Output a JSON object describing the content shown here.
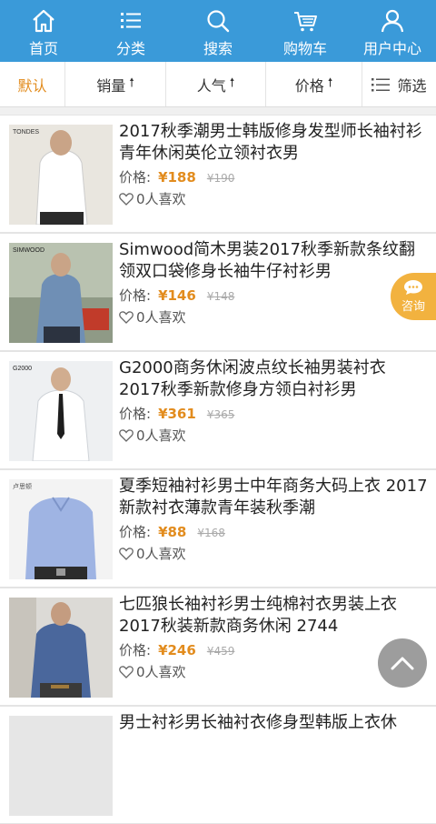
{
  "nav": {
    "items": [
      {
        "label": "首页",
        "icon": "home-icon"
      },
      {
        "label": "分类",
        "icon": "list-icon"
      },
      {
        "label": "搜索",
        "icon": "search-icon"
      },
      {
        "label": "购物车",
        "icon": "cart-icon"
      },
      {
        "label": "用户中心",
        "icon": "user-icon"
      }
    ]
  },
  "sort": {
    "default": "默认",
    "sales": "销量",
    "popularity": "人气",
    "price": "价格",
    "filter": "筛选",
    "arrow": "🠕"
  },
  "products": [
    {
      "title": "2017秋季潮男士韩版修身发型师长袖衬衫 青年休闲英伦立领衬衣男",
      "price_label": "价格:",
      "price": "¥188",
      "old_price": "¥190",
      "likes": "0人喜欢",
      "thumb_brand": "TONDES"
    },
    {
      "title": "Simwood简木男装2017秋季新款条纹翻领双口袋修身长袖牛仔衬衫男",
      "price_label": "价格:",
      "price": "¥146",
      "old_price": "¥148",
      "likes": "0人喜欢",
      "thumb_brand": "SIMWOOD"
    },
    {
      "title": "G2000商务休闲波点纹长袖男装衬衣 2017秋季新款修身方领白衬衫男",
      "price_label": "价格:",
      "price": "¥361",
      "old_price": "¥365",
      "likes": "0人喜欢",
      "thumb_brand": "G2000"
    },
    {
      "title": "夏季短袖衬衫男士中年商务大码上衣 2017新款衬衣薄款青年装秋季潮",
      "price_label": "价格:",
      "price": "¥88",
      "old_price": "¥168",
      "likes": "0人喜欢",
      "thumb_brand": "卢思顿"
    },
    {
      "title": "七匹狼长袖衬衫男士纯棉衬衣男装上衣 2017秋装新款商务休闲 2744",
      "price_label": "价格:",
      "price": "¥246",
      "old_price": "¥459",
      "likes": "0人喜欢",
      "thumb_brand": ""
    },
    {
      "title": "男士衬衫男长袖衬衣修身型韩版上衣休",
      "price_label": "",
      "price": "",
      "old_price": "",
      "likes": "",
      "thumb_brand": ""
    }
  ],
  "consult": {
    "label": "咨询"
  },
  "colors": {
    "nav_bg": "#3a9ad9",
    "accent": "#e28c1e",
    "consult_bg": "#f2b23f",
    "totop_bg": "#9d9d9d"
  }
}
